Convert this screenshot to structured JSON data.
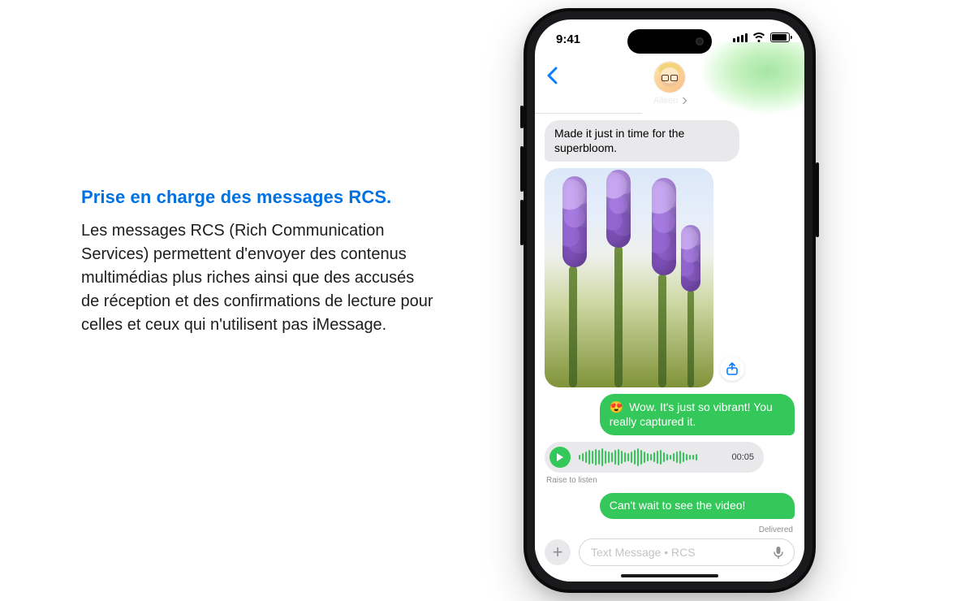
{
  "copy": {
    "heading": "Prise en charge des messages RCS.",
    "body": "Les messages RCS (Rich Communication Services) permettent d'envoyer des contenus multimédias plus riches ainsi que des accusés de réception et des confirmations de lecture pour celles et ceux qui n'utilisent pas iMessage."
  },
  "phone": {
    "status": {
      "time": "9:41"
    },
    "header": {
      "contact_name": "Aileen"
    },
    "thread": {
      "incoming_text_1": "Made it just in time for the superbloom.",
      "outgoing_text_1_emoji": "😍",
      "outgoing_text_1": " Wow. It's just so vibrant! You really captured it.",
      "voice": {
        "duration": "00:05",
        "hint": "Raise to listen",
        "wave_heights": [
          6,
          10,
          14,
          18,
          16,
          20,
          18,
          22,
          16,
          14,
          12,
          18,
          20,
          16,
          12,
          10,
          14,
          18,
          22,
          18,
          14,
          10,
          8,
          12,
          16,
          18,
          12,
          8,
          6,
          10,
          14,
          16,
          12,
          8,
          6,
          6,
          8
        ]
      },
      "outgoing_text_2": "Can't wait to see the video!",
      "delivered_label": "Delivered"
    },
    "composer": {
      "placeholder": "Text Message • RCS"
    }
  },
  "colors": {
    "accent_blue": "#0071e3",
    "sms_green": "#34c759",
    "bubble_gray": "#e9e9eb"
  }
}
